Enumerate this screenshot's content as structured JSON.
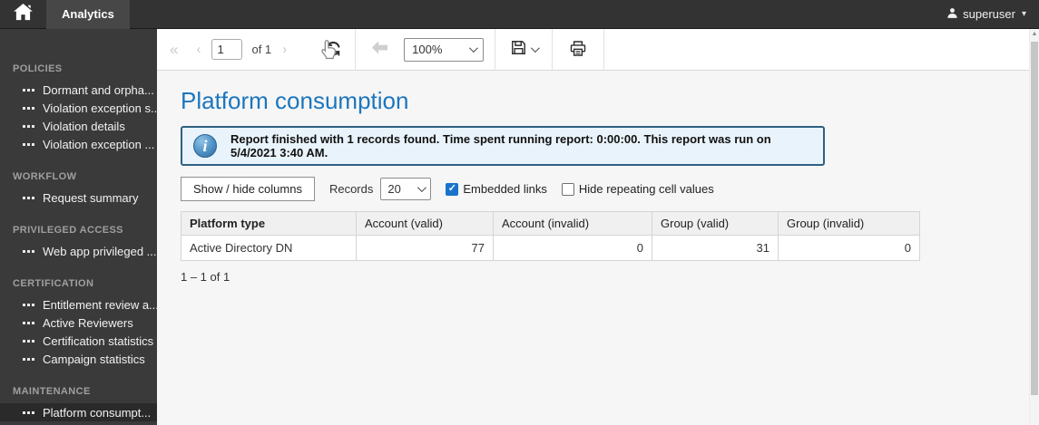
{
  "topbar": {
    "tab_label": "Analytics",
    "username": "superuser"
  },
  "sidebar": {
    "sections": [
      {
        "title": "POLICIES",
        "items": [
          "Dormant and orpha...",
          "Violation exception s...",
          "Violation details",
          "Violation exception ..."
        ]
      },
      {
        "title": "WORKFLOW",
        "items": [
          "Request summary"
        ]
      },
      {
        "title": "PRIVILEGED ACCESS",
        "items": [
          "Web app privileged ..."
        ]
      },
      {
        "title": "CERTIFICATION",
        "items": [
          "Entitlement review a...",
          "Active Reviewers",
          "Certification statistics",
          "Campaign statistics"
        ]
      },
      {
        "title": "MAINTENANCE",
        "items": [
          "Platform consumpt..."
        ]
      }
    ],
    "selected_item": "Platform consumpt..."
  },
  "toolbar": {
    "page_value": "1",
    "pages_label": "of 1",
    "zoom_value": "100%"
  },
  "report": {
    "title": "Platform consumption",
    "info_message": "Report finished with 1 records found. Time spent running report: 0:00:00. This report was run on 5/4/2021 3:40 AM.",
    "pagination_summary": "1 – 1 of 1"
  },
  "controls": {
    "show_hide_columns_label": "Show / hide columns",
    "records_label": "Records",
    "records_value": "20",
    "embedded_links_label": "Embedded links",
    "embedded_links_checked": true,
    "hide_repeating_label": "Hide repeating cell values",
    "hide_repeating_checked": false
  },
  "table": {
    "columns": [
      "Platform type",
      "Account (valid)",
      "Account (invalid)",
      "Group (valid)",
      "Group (invalid)"
    ],
    "rows": [
      [
        "Active Directory DN",
        "77",
        "0",
        "31",
        "0"
      ]
    ]
  },
  "icons": {
    "first_page": "«",
    "prev_page": "‹",
    "next_page": "›",
    "caret_down": "▾",
    "scroll_up": "▲",
    "check": "✓",
    "info": "i"
  },
  "colors": {
    "title_blue": "#1c76bd",
    "info_box_bg": "#e9f3fb",
    "info_box_border": "#2f6080",
    "checkbox_checked": "#1873cc",
    "topbar_bg": "#333333",
    "sidebar_bg": "#3a3a3a",
    "sidebar_selected_bg": "#2a2a2a"
  }
}
